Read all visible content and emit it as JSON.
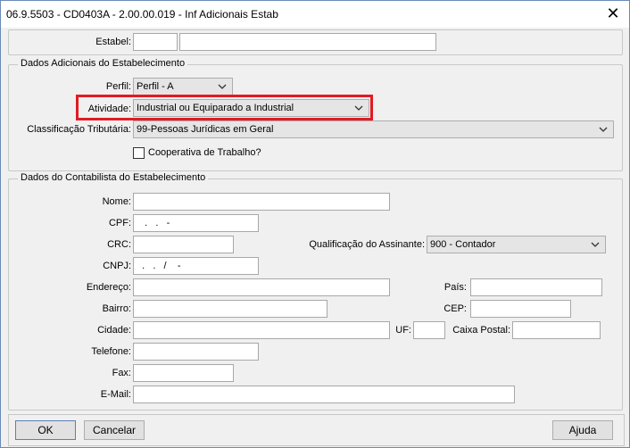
{
  "window": {
    "title": "06.9.5503 - CD0403A - 2.00.00.019 - Inf Adicionais Estab",
    "close_glyph": "✕"
  },
  "top": {
    "estabel_label": "Estabel:",
    "estabel_code": "",
    "estabel_name": ""
  },
  "dados_adicionais": {
    "legend": "Dados Adicionais do Estabelecimento",
    "perfil_label": "Perfil:",
    "perfil_value": "Perfil - A",
    "atividade_label": "Atividade:",
    "atividade_value": "Industrial ou Equiparado a Industrial",
    "classificacao_label": "Classificação Tributária:",
    "classificacao_value": "99-Pessoas Jurídicas em Geral",
    "cooperativa_label": "Cooperativa de Trabalho?",
    "cooperativa_checked": false
  },
  "contabilista": {
    "legend": "Dados do Contabilista do Estabelecimento",
    "nome_label": "Nome:",
    "nome_value": "",
    "cpf_label": "CPF:",
    "cpf_value": "   .   .   -",
    "crc_label": "CRC:",
    "crc_value": "",
    "qualificacao_label": "Qualificação do Assinante:",
    "qualificacao_value": "900 - Contador",
    "cnpj_label": "CNPJ:",
    "cnpj_value": "  .   .   /    -",
    "endereco_label": "Endereço:",
    "endereco_value": "",
    "pais_label": "País:",
    "pais_value": "",
    "bairro_label": "Bairro:",
    "bairro_value": "",
    "cep_label": "CEP:",
    "cep_value": "",
    "cidade_label": "Cidade:",
    "cidade_value": "",
    "uf_label": "UF:",
    "uf_value": "",
    "caixa_label": "Caixa Postal:",
    "caixa_value": "",
    "telefone_label": "Telefone:",
    "telefone_value": "",
    "fax_label": "Fax:",
    "fax_value": "",
    "email_label": "E-Mail:",
    "email_value": ""
  },
  "footer": {
    "ok_label": "OK",
    "cancelar_label": "Cancelar",
    "ajuda_label": "Ajuda"
  },
  "colors": {
    "highlight": "#e01b24",
    "title_border": "#6a8ab8"
  },
  "icons": {
    "dropdown": "chevron-down-icon",
    "close": "close-icon"
  }
}
